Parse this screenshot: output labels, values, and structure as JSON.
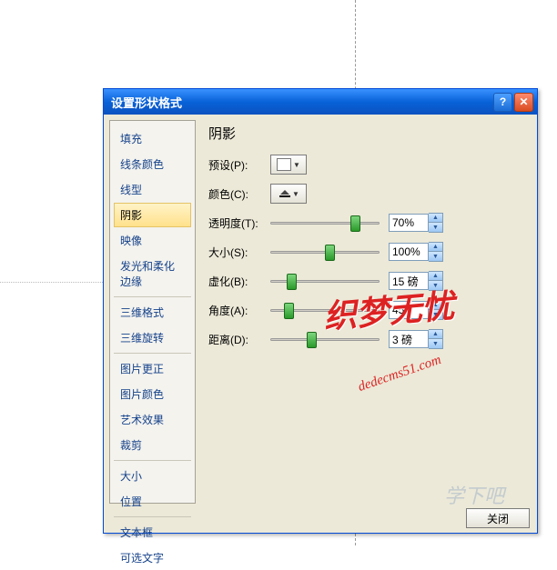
{
  "dialog": {
    "title": "设置形状格式"
  },
  "sidebar": {
    "items": [
      {
        "label": "填充"
      },
      {
        "label": "线条颜色"
      },
      {
        "label": "线型"
      },
      {
        "label": "阴影",
        "selected": true
      },
      {
        "label": "映像"
      },
      {
        "label": "发光和柔化边缘"
      },
      {
        "sep": true
      },
      {
        "label": "三维格式"
      },
      {
        "label": "三维旋转"
      },
      {
        "sep": true
      },
      {
        "label": "图片更正"
      },
      {
        "label": "图片颜色"
      },
      {
        "label": "艺术效果"
      },
      {
        "label": "裁剪"
      },
      {
        "sep": true
      },
      {
        "label": "大小"
      },
      {
        "label": "位置"
      },
      {
        "sep": true
      },
      {
        "label": "文本框"
      },
      {
        "label": "可选文字"
      }
    ]
  },
  "panel": {
    "title": "阴影",
    "preset_label": "预设(P):",
    "color_label": "颜色(C):",
    "rows": [
      {
        "label": "透明度(T):",
        "value": "70%",
        "thumb": 88
      },
      {
        "label": "大小(S):",
        "value": "100%",
        "thumb": 60
      },
      {
        "label": "虚化(B):",
        "value": "15 磅",
        "thumb": 18
      },
      {
        "label": "角度(A):",
        "value": "45°",
        "thumb": 15
      },
      {
        "label": "距离(D):",
        "value": "3 磅",
        "thumb": 40
      }
    ]
  },
  "footer": {
    "close_label": "关闭"
  },
  "watermark": {
    "main": "织梦无忧",
    "sub": "dedecms51.com",
    "site": "学下吧"
  }
}
